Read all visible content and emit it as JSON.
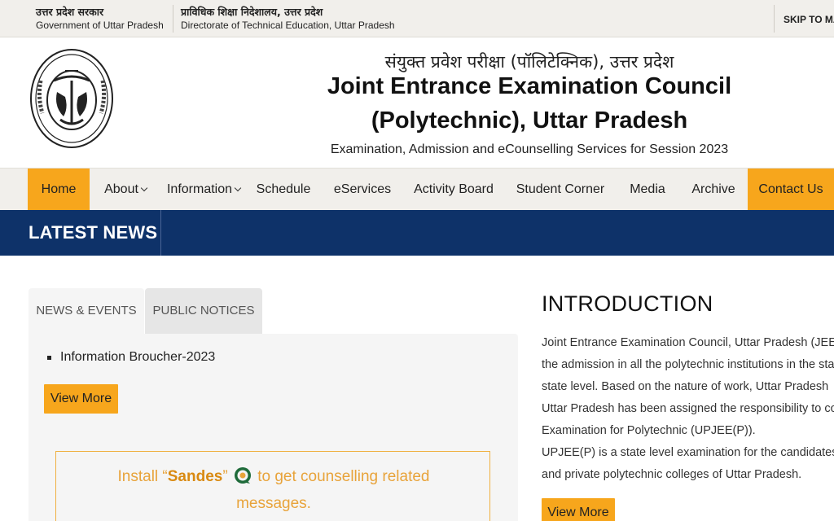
{
  "topbar": {
    "gov_hindi": "उत्तर प्रदेश सरकार",
    "gov_english": "Government of Uttar Pradesh",
    "dte_hindi": "प्राविधिक शिक्षा निदेशालय, उत्तर प्रदेश",
    "dte_english": "Directorate of Technical Education, Uttar Pradesh",
    "skip_label": "SKIP TO MA"
  },
  "header": {
    "hindi_title": "संयुक्त प्रवेश परीक्षा (पॉलिटेक्निक), उत्तर प्रदेश",
    "title_line1": "Joint Entrance Examination Council",
    "title_line2": "(Polytechnic), Uttar Pradesh",
    "subtitle": "Examination, Admission and eCounselling Services for Session 2023",
    "emblem_icon": "up-government-emblem-icon"
  },
  "nav": {
    "items": [
      {
        "label": "Home",
        "active": true
      },
      {
        "label": "About",
        "dropdown": true
      },
      {
        "label": "Information",
        "dropdown": true
      },
      {
        "label": "Schedule"
      },
      {
        "label": "eServices"
      },
      {
        "label": "Activity Board"
      },
      {
        "label": "Student Corner"
      },
      {
        "label": "Media"
      },
      {
        "label": "Archive"
      },
      {
        "label": "Contact Us",
        "active": true
      }
    ]
  },
  "news_bar": {
    "label": "LATEST NEWS"
  },
  "tabs": {
    "news_events": "NEWS & EVENTS",
    "public_notices": "PUBLIC NOTICES"
  },
  "news": {
    "items": [
      "Information Broucher-2023"
    ],
    "view_more": "View More"
  },
  "sandes": {
    "before": "Install “",
    "app_name": "Sandes",
    "after_quote": "”",
    "after": " to get counselling related",
    "line2": "messages."
  },
  "intro": {
    "title": "INTRODUCTION",
    "lines": [
      "Joint Entrance Examination Council, Uttar Pradesh (JEECUP)",
      "the admission in all the polytechnic institutions in the state",
      "state level. Based on the nature of work, Uttar Pradesh",
      "Uttar Pradesh has been assigned the responsibility to conduct",
      "Examination for Polytechnic (UPJEE(P)).",
      "UPJEE(P) is a state level examination for the candidates",
      "and private polytechnic colleges of Uttar Pradesh."
    ],
    "view_more": "View More"
  },
  "colors": {
    "accent_orange": "#f7a61c",
    "navy": "#0e3269",
    "bar_bg": "#f1efeb"
  }
}
